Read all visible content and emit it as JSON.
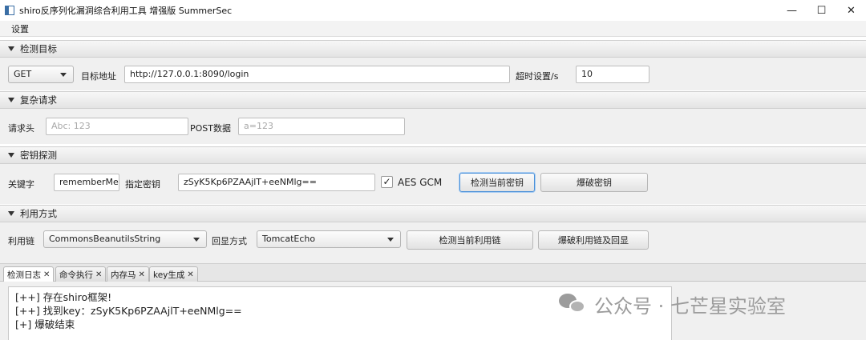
{
  "window": {
    "title": "shiro反序列化漏洞综合利用工具 增强版 SummerSec",
    "minimize_glyph": "—",
    "maximize_glyph": "☐",
    "close_glyph": "✕"
  },
  "menu": {
    "settings": "设置"
  },
  "target": {
    "header": "检测目标",
    "method": "GET",
    "url_label": "目标地址",
    "url_value": "http://127.0.0.1:8090/login",
    "timeout_label": "超时设置/s",
    "timeout_value": "10"
  },
  "complex": {
    "header": "复杂请求",
    "headers_label": "请求头",
    "headers_placeholder": "Abc: 123",
    "post_label": "POST数据",
    "post_placeholder": "a=123"
  },
  "key": {
    "header": "密钥探测",
    "keyword_label": "关键字",
    "keyword_value": "rememberMe",
    "key_label": "指定密钥",
    "key_value": "zSyK5Kp6PZAAjlT+eeNMlg==",
    "aes_gcm_label": "AES GCM",
    "aes_gcm_checked": true,
    "check_mark": "✓",
    "detect_button": "检测当前密钥",
    "brute_button": "爆破密钥"
  },
  "exploit": {
    "header": "利用方式",
    "chain_label": "利用链",
    "chain_value": "CommonsBeanutilsString",
    "echo_label": "回显方式",
    "echo_value": "TomcatEcho",
    "detect_chain_button": "检测当前利用链",
    "brute_chain_button": "爆破利用链及回显"
  },
  "tabs": [
    {
      "label": "检测日志",
      "close": "✕"
    },
    {
      "label": "命令执行",
      "close": "✕"
    },
    {
      "label": "内存马",
      "close": "✕"
    },
    {
      "label": "key生成",
      "close": "✕"
    }
  ],
  "log": {
    "lines": [
      "[++] 存在shiro框架!",
      "[++] 找到key：zSyK5Kp6PZAAjlT+eeNMlg==",
      "[+] 爆破结束"
    ]
  },
  "watermark": {
    "text": "公众号 · 七芒星实验室"
  }
}
